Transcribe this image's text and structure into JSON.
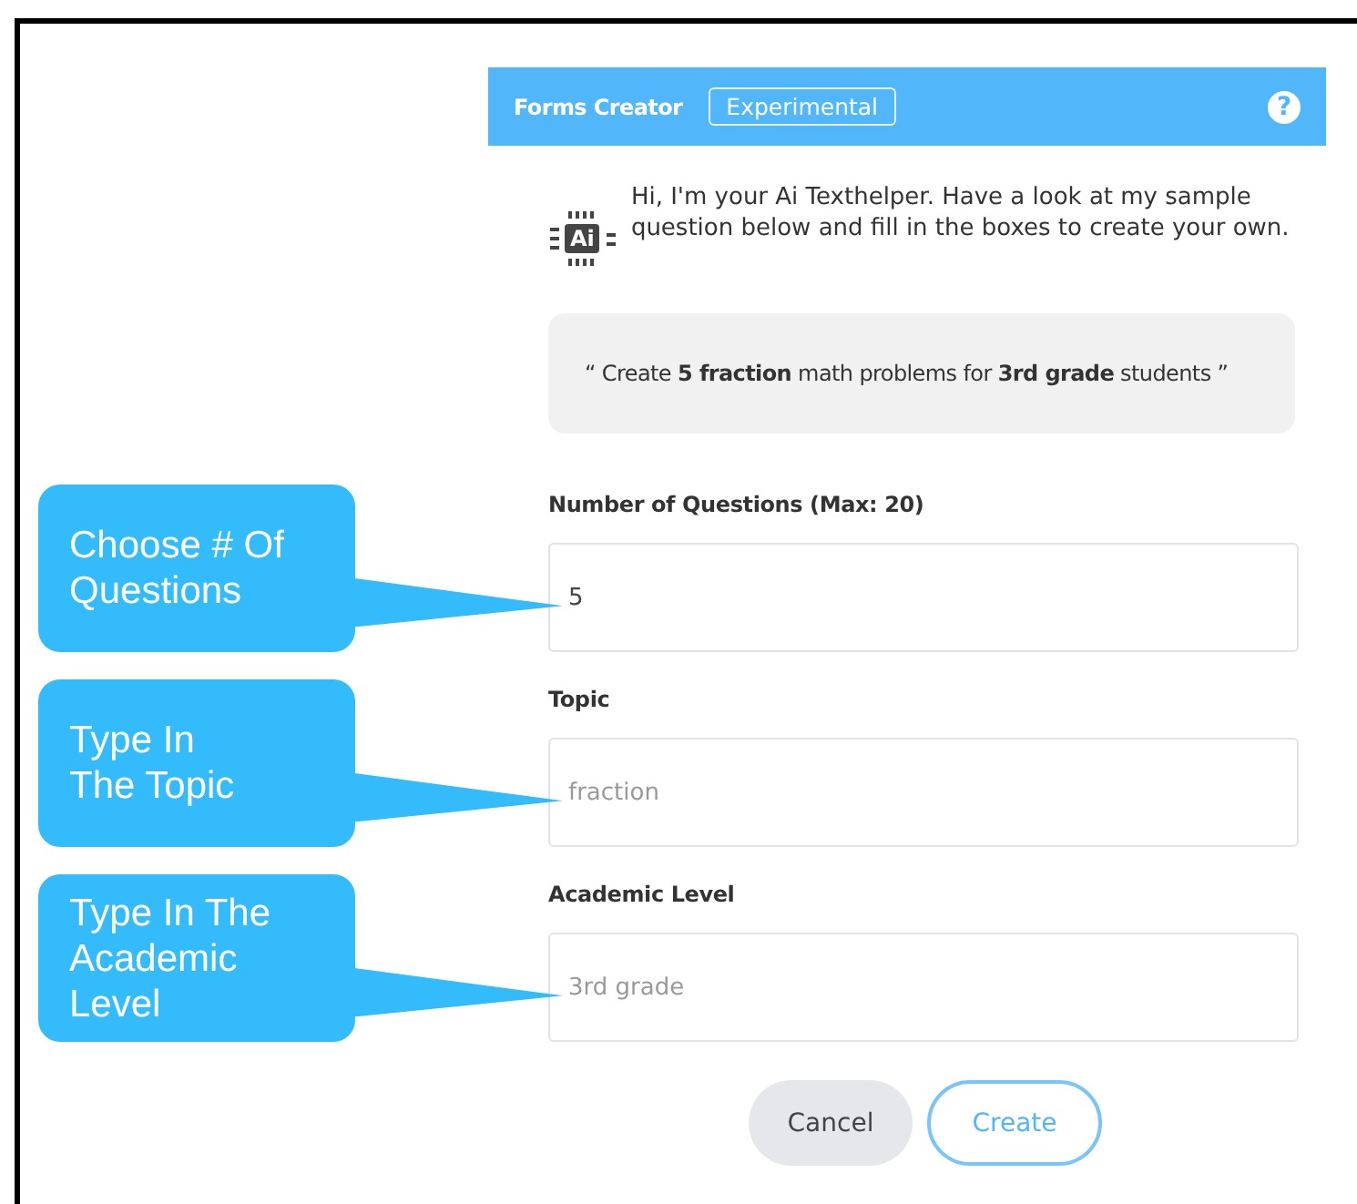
{
  "header": {
    "title": "Forms Creator",
    "badge": "Experimental",
    "help": "?"
  },
  "intro": {
    "chip_label": "Ai",
    "text": "Hi, I'm your Ai Texthelper. Have a look at my sample question below and fill in the boxes to create your own."
  },
  "sample": "“ Create **5 fraction** math problems for **3rd grade** students ”",
  "fields": [
    {
      "label": "Number of Questions (Max: 20)",
      "value": "5",
      "callout": "Choose # Of\nQuestions"
    },
    {
      "label": "Topic",
      "placeholder": "fraction",
      "callout": "Type In\nThe Topic"
    },
    {
      "label": "Academic Level",
      "placeholder": "3rd grade",
      "callout": "Type In The\nAcademic\nLevel"
    }
  ],
  "buttons": [
    {
      "label": "Cancel",
      "kind": "secondary"
    },
    {
      "label": "Create",
      "kind": "primary"
    }
  ]
}
